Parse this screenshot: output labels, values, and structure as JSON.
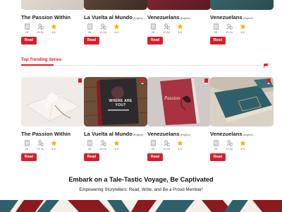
{
  "top_cards": [
    {
      "title": "The Passion Within",
      "lang": "",
      "pages": "25",
      "reads": "12.1k",
      "rating": "4.6",
      "read_label": "Read"
    },
    {
      "title": "La Vuelta al Mundo",
      "lang": "(English)",
      "pages": "25",
      "reads": "12.1k",
      "rating": "4.6",
      "read_label": "Read"
    },
    {
      "title": "Venezuelans",
      "lang": "(English)",
      "pages": "25",
      "reads": "12.1k",
      "rating": "4.6",
      "read_label": "Read"
    },
    {
      "title": "Venezuelans",
      "lang": "(English)",
      "pages": "25",
      "reads": "12.1k",
      "rating": "4.6",
      "read_label": "Read"
    }
  ],
  "section": {
    "title": "Top Trending Series"
  },
  "trending_cards": [
    {
      "title": "The Passion Within",
      "lang": "",
      "pages": "25",
      "reads": "12.1k",
      "rating": "4.6",
      "read_label": "Read",
      "cover_text": ""
    },
    {
      "title": "La Vuelta al Mundo",
      "lang": "(English)",
      "pages": "25",
      "reads": "12.1k",
      "rating": "4.6",
      "read_label": "Read",
      "cover_text": "WHERE ARE YOU?"
    },
    {
      "title": "Venezuelans",
      "lang": "(English)",
      "pages": "25",
      "reads": "12.1k",
      "rating": "4.6",
      "read_label": "Read",
      "cover_text": "Passion"
    },
    {
      "title": "Venezuelans",
      "lang": "(English)",
      "pages": "25",
      "reads": "12.1k",
      "rating": "4.6",
      "read_label": "Read",
      "cover_text": ""
    }
  ],
  "promo": {
    "headline": "Embark on a Tale-Tastic Voyage, Be Captivated",
    "subline": "Empowering Storytellers: Read, Write, and Be a Proud Member!"
  },
  "colors": {
    "accent": "#d81e2a",
    "star": "#f5b301",
    "footer_red": "#8b1a1f",
    "footer_teal": "#2f5f6b",
    "footer_cream": "#f4efe6"
  },
  "icons": [
    "pages-icon",
    "reads-icon",
    "star-icon",
    "bookmark-icon",
    "flag-icon"
  ]
}
